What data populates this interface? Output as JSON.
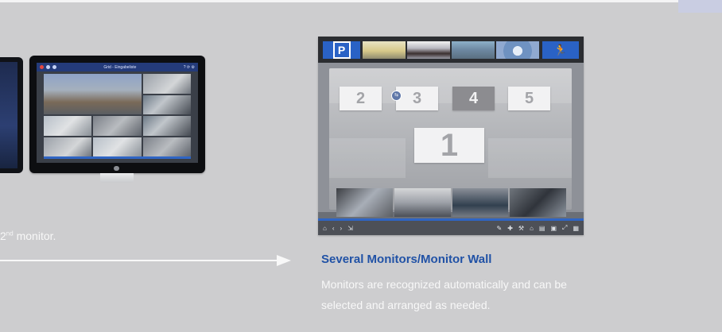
{
  "left_caption": {
    "sup_number": "2",
    "sup_suffix": "nd",
    "text": " monitor."
  },
  "imac_app": {
    "title": "Grid - Eingabeliste",
    "status_right": "? ⟳ ⚙"
  },
  "monitor_wall": {
    "camera_tiles": [
      {
        "name": "parking",
        "label": "P"
      },
      {
        "name": "building"
      },
      {
        "name": "conference"
      },
      {
        "name": "yard"
      },
      {
        "name": "dome"
      },
      {
        "name": "emergency-exit",
        "label": "🏃"
      }
    ],
    "badge": "⇆",
    "monitor_numbers": [
      "2",
      "3",
      "4",
      "5",
      "1"
    ],
    "selected_monitor": "4",
    "bottom_toolbar_left": [
      "⌂",
      "‹",
      "›",
      "⇲"
    ],
    "bottom_toolbar_right": [
      "✎",
      "✚",
      "⚒",
      "⌂",
      "▤",
      "▣",
      "⤢",
      "▦"
    ]
  },
  "feature": {
    "title": "Several Monitors/Monitor Wall",
    "description": "Monitors are recognized automatically and can be selected and arranged as needed."
  },
  "colors": {
    "accent_blue": "#2152a6",
    "background": "#cdcdcf",
    "caption_text": "#f8f8f8"
  }
}
